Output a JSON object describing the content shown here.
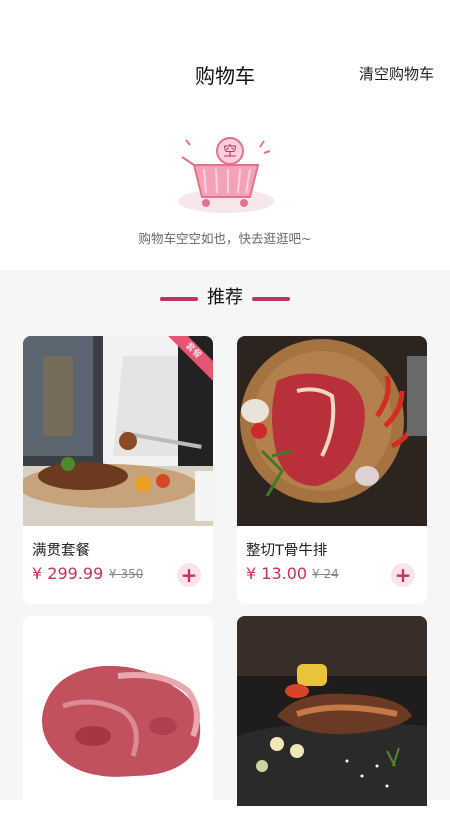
{
  "header": {
    "title": "购物车",
    "clear_label": "清空购物车"
  },
  "empty_state": {
    "message": "购物车空空如也，快去逛逛吧~",
    "illustration_text": "空"
  },
  "recommend": {
    "title": "推荐",
    "products": [
      {
        "name": "满贯套餐",
        "price": "¥ 299.99",
        "old_price": "¥ 350",
        "badge": "套餐",
        "image": "steak-meal-photo"
      },
      {
        "name": "整切T骨牛排",
        "price": "¥ 13.00",
        "old_price": "¥ 24",
        "image": "t-bone-steak-photo"
      },
      {
        "image": "raw-beef-photo"
      },
      {
        "image": "grilled-steak-photo"
      }
    ]
  },
  "colors": {
    "accent": "#c9305a",
    "page_bg": "#f6f6f6"
  }
}
